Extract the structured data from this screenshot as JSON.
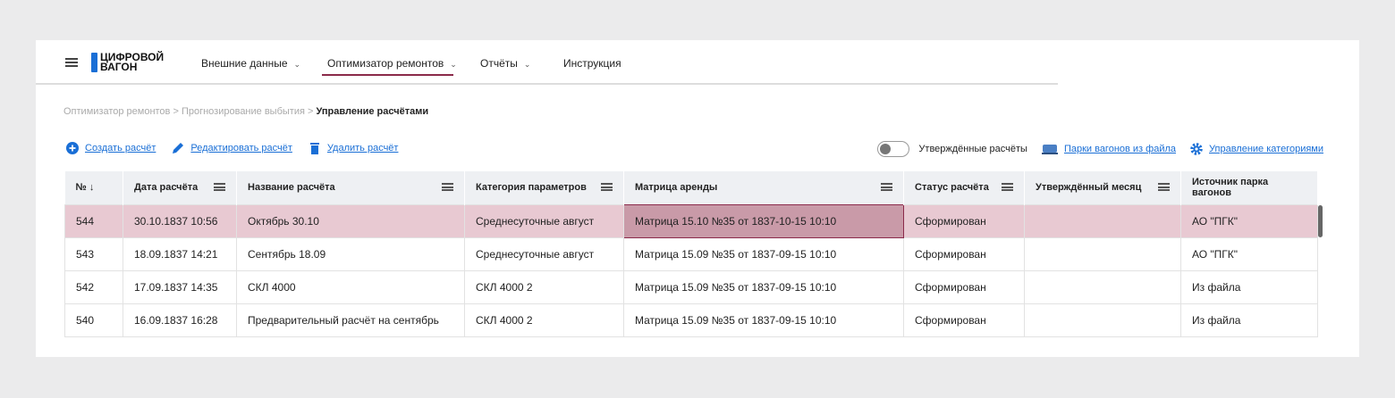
{
  "logo": {
    "line1": "ЦИФРОВОЙ",
    "line2": "ВАГОН"
  },
  "nav": [
    {
      "label": "Внешние данные",
      "dropdown": true
    },
    {
      "label": "Оптимизатор ремонтов",
      "dropdown": true,
      "active": true
    },
    {
      "label": "Отчёты",
      "dropdown": true
    },
    {
      "label": "Инструкция",
      "dropdown": false
    }
  ],
  "breadcrumb": [
    "Оптимизатор ремонтов",
    "Прогнозирование выбытия",
    "Управление расчётами"
  ],
  "actions": {
    "create": "Создать расчёт",
    "edit": "Редактировать расчёт",
    "delete": "Удалить расчёт",
    "approved_toggle": "Утверждённые расчёты",
    "approved_on": false,
    "fleets": "Парки вагонов из файла",
    "categories": "Управление категориями"
  },
  "colors": {
    "accent": "#1a6fd6",
    "active": "#8b2a4a",
    "selected_row": "#e8c9d2"
  },
  "table": {
    "headers": [
      "№",
      "Дата расчёта",
      "Название расчёта",
      "Категория параметров",
      "Матрица аренды",
      "Статус расчёта",
      "Утверждённый месяц",
      "Источник парка вагонов"
    ],
    "sort": "№ descending",
    "rows": [
      [
        "544",
        "30.10.1837 10:56",
        "Октябрь 30.10",
        "Среднесуточные август",
        "Матрица 15.10 №35 от 1837-10-15 10:10",
        "Сформирован",
        "",
        "АО \"ПГК\""
      ],
      [
        "543",
        "18.09.1837 14:21",
        "Сентябрь 18.09",
        "Среднесуточные август",
        "Матрица 15.09 №35 от 1837-09-15 10:10",
        "Сформирован",
        "",
        "АО \"ПГК\""
      ],
      [
        "542",
        "17.09.1837 14:35",
        "СКЛ 4000",
        "СКЛ 4000 2",
        "Матрица 15.09 №35 от 1837-09-15 10:10",
        "Сформирован",
        "",
        "Из файла"
      ],
      [
        "540",
        "16.09.1837 16:28",
        "Предварительный расчёт на сентябрь",
        "СКЛ 4000 2",
        "Матрица 15.09 №35 от 1837-09-15 10:10",
        "Сформирован",
        "",
        "Из файла"
      ]
    ]
  }
}
